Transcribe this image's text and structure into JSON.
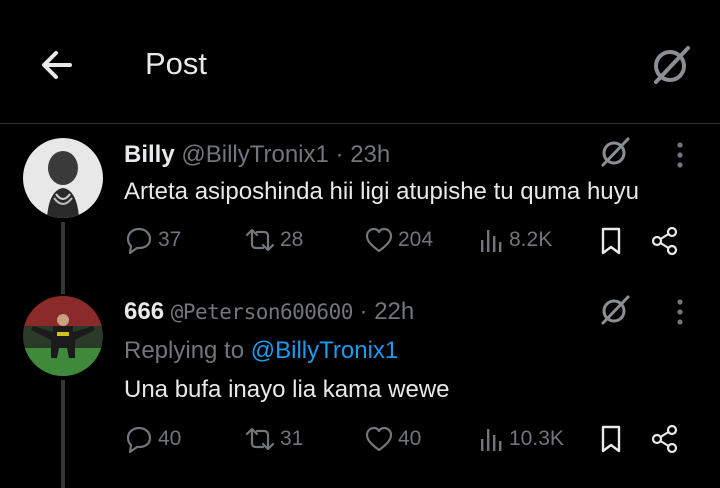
{
  "header": {
    "title": "Post"
  },
  "posts": [
    {
      "name": "Billy",
      "handle": "@BillyTronix1",
      "time": "· 23h",
      "text": "Arteta asiposhinda hii ligi atupishe tu quma huyu",
      "replying_to_label": "",
      "replying_to_handle": "",
      "stats": {
        "replies": "37",
        "reposts": "28",
        "likes": "204",
        "views": "8.2K"
      }
    },
    {
      "name": "666",
      "handle": "@Peterson600600",
      "time": "· 22h",
      "text": "Una bufa inayo lia kama wewe",
      "replying_to_label": "Replying to",
      "replying_to_handle": "@BillyTronix1",
      "stats": {
        "replies": "40",
        "reposts": "31",
        "likes": "40",
        "views": "10.3K"
      }
    }
  ],
  "icons": {
    "back": "arrow-left-icon",
    "grok": "grok-icon",
    "more": "more-vertical-icon",
    "reply": "reply-icon",
    "repost": "repost-icon",
    "like": "heart-icon",
    "views": "views-icon",
    "bookmark": "bookmark-icon",
    "share": "share-icon"
  },
  "colors": {
    "background": "#000000",
    "text": "#e7e9ea",
    "muted": "#71767b",
    "link": "#1d9bf0",
    "divider": "#2f3336"
  }
}
